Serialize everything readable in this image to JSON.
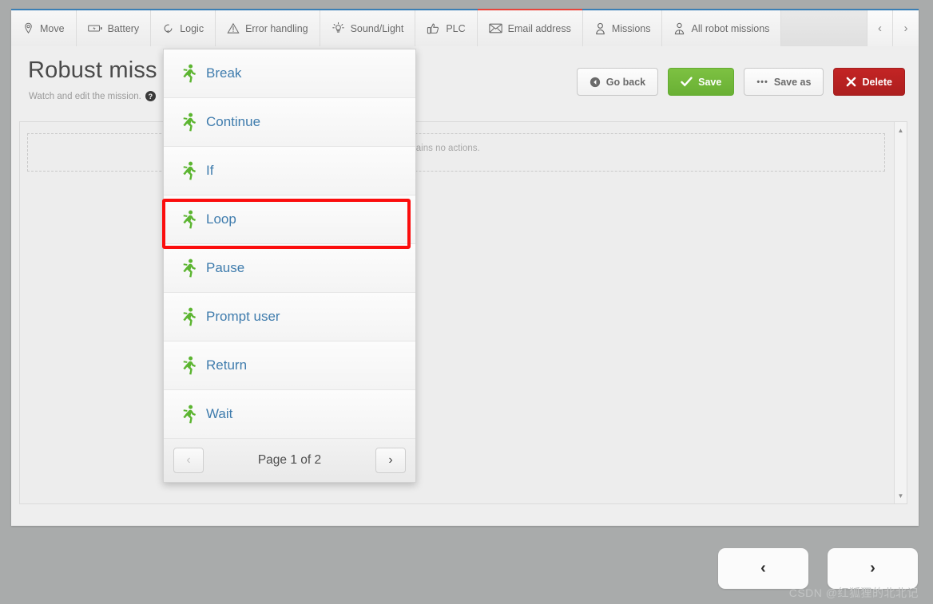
{
  "window": {
    "background_color": "#a9abab",
    "card_color": "#eeeeee"
  },
  "toolbar": {
    "accent_top_color": "#3b7fb5",
    "active_tab_color": "#e8453c",
    "tabs": [
      {
        "label": "Move",
        "icon": "map-pin-icon",
        "active": false
      },
      {
        "label": "Battery",
        "icon": "battery-icon",
        "active": false
      },
      {
        "label": "Logic",
        "icon": "loop-arrow-icon",
        "active": false
      },
      {
        "label": "Error handling",
        "icon": "warning-triangle-icon",
        "active": false
      },
      {
        "label": "Sound/Light",
        "icon": "lightbulb-icon",
        "active": false
      },
      {
        "label": "PLC",
        "icon": "thumbs-up-icon",
        "active": false
      },
      {
        "label": "Email address",
        "icon": "envelope-icon",
        "active": true
      },
      {
        "label": "Missions",
        "icon": "person-icon",
        "active": false
      },
      {
        "label": "All robot missions",
        "icon": "person-bust-icon",
        "active": false
      }
    ],
    "prev_arrow": "‹",
    "next_arrow": "›"
  },
  "header": {
    "title": "Robust miss",
    "subtitle": "Watch and edit the mission.",
    "help_glyph": "?"
  },
  "actions": [
    {
      "label": "Go back",
      "icon": "back-circle-icon",
      "style": "default",
      "glyph": "◀"
    },
    {
      "label": "Save",
      "icon": "checkmark-icon",
      "style": "green",
      "glyph": "✔"
    },
    {
      "label": "Save as",
      "icon": "ellipsis-icon",
      "style": "default",
      "glyph": "•••"
    },
    {
      "label": "Delete",
      "icon": "cross-icon",
      "style": "red",
      "glyph": "✖"
    }
  ],
  "content": {
    "empty_message": "ssion contains no actions.",
    "scroll_up_glyph": "▲",
    "scroll_down_glyph": "▼"
  },
  "dropdown": {
    "items": [
      {
        "label": "Break",
        "icon": "running-person-icon"
      },
      {
        "label": "Continue",
        "icon": "running-person-icon"
      },
      {
        "label": "If",
        "icon": "running-person-icon"
      },
      {
        "label": "Loop",
        "icon": "running-person-icon",
        "highlighted": true
      },
      {
        "label": "Pause",
        "icon": "running-person-icon"
      },
      {
        "label": "Prompt user",
        "icon": "running-person-icon"
      },
      {
        "label": "Return",
        "icon": "running-person-icon"
      },
      {
        "label": "Wait",
        "icon": "running-person-icon"
      }
    ],
    "pagination": {
      "label": "Page 1 of 2",
      "prev_glyph": "‹",
      "next_glyph": "›",
      "prev_disabled": true
    },
    "item_text_color": "#3f7cad",
    "icon_color": "#5cb531",
    "highlight_color": "#fb0d0d"
  },
  "bottom_nav": {
    "prev_glyph": "‹",
    "next_glyph": "›"
  },
  "watermark": {
    "text": "CSDN @红狐狸的北北记"
  }
}
